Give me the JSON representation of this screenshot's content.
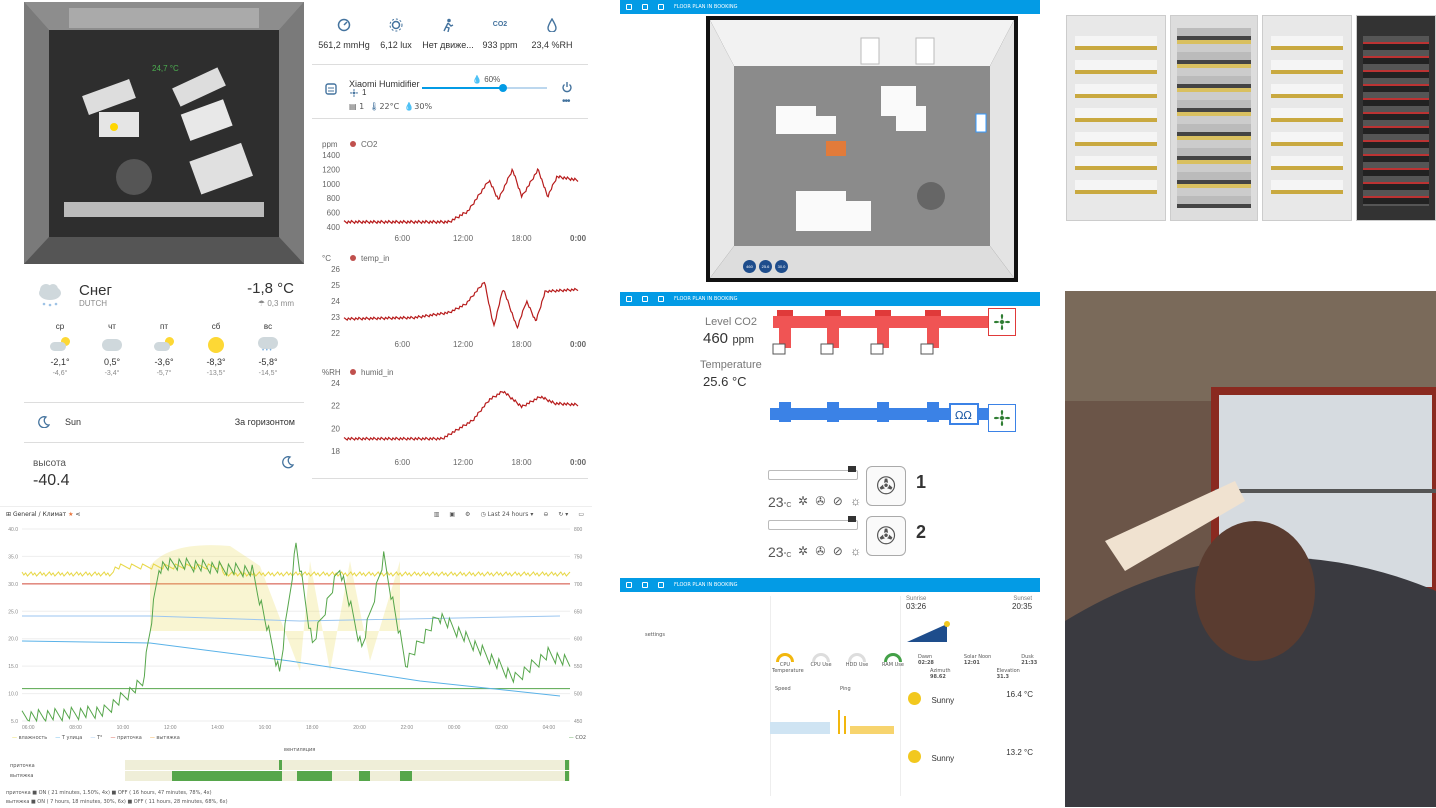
{
  "floor": {
    "temp_label": "24,7 °C"
  },
  "sensors": [
    {
      "icon": "gauge-icon",
      "value": "561,2 mmHg"
    },
    {
      "icon": "brightness-icon",
      "value": "6,12 lux"
    },
    {
      "icon": "motion-icon",
      "value": "Нет движе..."
    },
    {
      "icon": "co2-icon",
      "value": "933 ppm",
      "badge": "CO2"
    },
    {
      "icon": "humidity-icon",
      "value": "23,4 %RH"
    }
  ],
  "humidifier": {
    "name": "Xiaomi Humidifier",
    "target": "60%",
    "fan": "1",
    "level": "1",
    "temp": "22°C",
    "humidity": "30%",
    "slider_fraction": 0.65
  },
  "history": [
    {
      "unit": "ppm",
      "name": "CO2",
      "yticks": [
        "1400",
        "1200",
        "1000",
        "800",
        "600",
        "400"
      ],
      "xticks": [
        "6:00",
        "12:00",
        "18:00",
        "0:00"
      ]
    },
    {
      "unit": "°C",
      "name": "temp_in",
      "yticks": [
        "26",
        "25",
        "24",
        "23",
        "22"
      ],
      "xticks": [
        "6:00",
        "12:00",
        "18:00",
        "0:00"
      ]
    },
    {
      "unit": "%RH",
      "name": "humid_in",
      "yticks": [
        "24",
        "22",
        "20",
        "18"
      ],
      "xticks": [
        "6:00",
        "12:00",
        "18:00",
        "0:00"
      ]
    }
  ],
  "weather": {
    "condition": "Снег",
    "source": "DUTCH",
    "temp": "-1,8 °C",
    "precip": "0,3 mm",
    "forecast": [
      {
        "day": "ср",
        "icon": "partly-cloudy-icon",
        "high": "-2,1°",
        "low": "-4,6°"
      },
      {
        "day": "чт",
        "icon": "cloudy-icon",
        "high": "0,5°",
        "low": "-3,4°"
      },
      {
        "day": "пт",
        "icon": "partly-cloudy-icon",
        "high": "-3,6°",
        "low": "-5,7°"
      },
      {
        "day": "сб",
        "icon": "sun-icon",
        "high": "-8,3°",
        "low": "-13,5°"
      },
      {
        "day": "вс",
        "icon": "snow-icon",
        "high": "-5,8°",
        "low": "-14,5°"
      }
    ]
  },
  "sun": {
    "label": "Sun",
    "state": "За горизонтом"
  },
  "elevation": {
    "label": "высота",
    "value": "-40.4"
  },
  "grafana": {
    "breadcrumb_root": "General",
    "breadcrumb_sep": "/",
    "breadcrumb_page": "Климат",
    "time_range": "Last 24 hours",
    "left_ticks": [
      "40.0",
      "35.0",
      "30.0",
      "25.0",
      "20.0",
      "15.0",
      "10.0",
      "5.0"
    ],
    "right_ticks": [
      "800",
      "750",
      "700",
      "650",
      "600",
      "550",
      "500",
      "450"
    ],
    "x_ticks": [
      "06:00",
      "08:00",
      "10:00",
      "12:00",
      "14:00",
      "16:00",
      "18:00",
      "20:00",
      "22:00",
      "00:00",
      "02:00",
      "04:00"
    ],
    "legend": [
      {
        "name": "влажность",
        "color": "#e8d84a"
      },
      {
        "name": "T улица",
        "color": "#5ab2e8"
      },
      {
        "name": "T°",
        "color": "#9bc6f0"
      },
      {
        "name": "приточка",
        "color": "#d44a3a"
      },
      {
        "name": "вытяжка",
        "color": "#f2a33a"
      }
    ],
    "legend_right": "CO2",
    "vent_title": "вентиляция",
    "vent_rows": [
      "приточка",
      "вытяжка"
    ],
    "stats": [
      "приточка ■ ON ( 21 minutes, 1.50%, 4x)  ■ OFF ( 16 hours, 47 minutes, 78%, 4x)",
      "вытяжка ■ ON ( 7 hours, 18 minutes, 30%, 6x)  ■ OFF ( 11 hours, 28 minutes, 68%, 6x)"
    ]
  },
  "floorplan_header": "FLOOR PLAN IN BOOKING",
  "floorplan_badges": [
    "460",
    "25.6",
    "30.0"
  ],
  "ventilation": {
    "co2_label": "Level CO2",
    "co2_value": "460",
    "co2_unit": "ppm",
    "temp_label": "Temperature",
    "temp_value": "25.6",
    "temp_unit": "°C",
    "ac": [
      {
        "temp": "23",
        "unit": "°C",
        "num": "1"
      },
      {
        "temp": "23",
        "unit": "°C",
        "num": "2"
      }
    ]
  },
  "dash3": {
    "times": [
      {
        "label": "Sunrise",
        "value": "03:26"
      },
      {
        "label": "Sunset",
        "value": "20:35"
      }
    ],
    "dawn": [
      {
        "label": "Dawn",
        "value": "02:28"
      },
      {
        "label": "Solar Noon",
        "value": "12:01"
      },
      {
        "label": "Dusk",
        "value": "21:33"
      }
    ],
    "azimuth": [
      {
        "label": "Azimuth",
        "value": "98.62"
      },
      {
        "label": "Elevation",
        "value": "31.3"
      }
    ],
    "gauges": [
      "CPU Temperature",
      "CPU Use",
      "HDD Use",
      "RAM Use"
    ],
    "speed": "Speed",
    "ping": "Ping",
    "settings": "settings",
    "w1": {
      "cond": "Sunny",
      "temp": "16.4 °C"
    },
    "w2": {
      "cond": "Sunny",
      "temp": "13.2 °C"
    }
  },
  "colors": {
    "accent": "#039be5",
    "line": "#b71c1c",
    "pipe_red": "#f05454",
    "pipe_blue": "#3b82e6"
  }
}
